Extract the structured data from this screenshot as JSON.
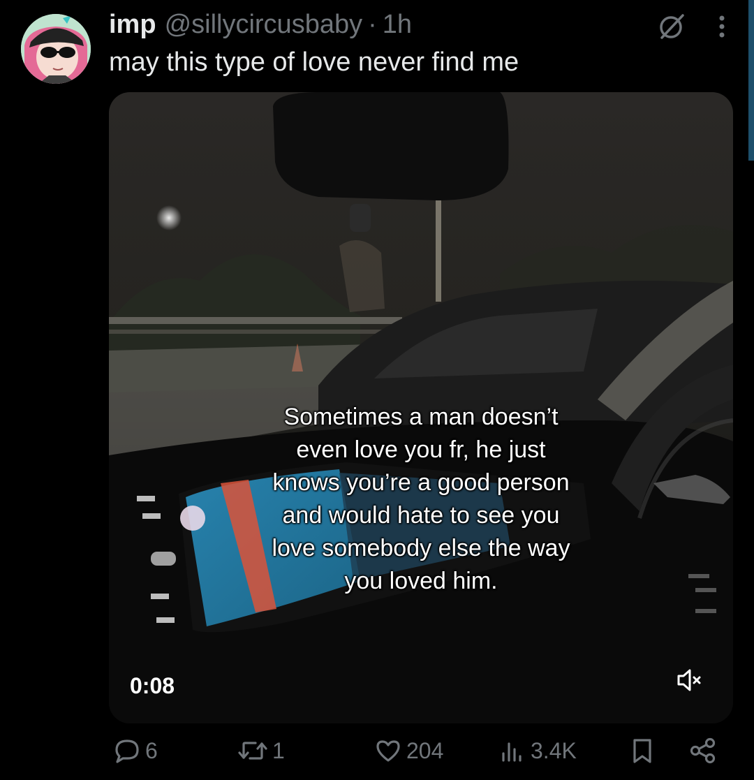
{
  "author": {
    "display_name": "imp",
    "handle": "@sillycircusbaby",
    "separator": "·",
    "time": "1h"
  },
  "tweet": {
    "text": "may this type of love never find me"
  },
  "top_icons": [
    "grok-icon",
    "more-icon"
  ],
  "media": {
    "caption_lines": [
      "Sometimes a man doesn’t",
      "even love you fr, he just",
      "knows you’re a good person",
      "and would hate to see you",
      "love somebody else the way",
      "you loved him."
    ],
    "elapsed_time": "0:08",
    "muted": true
  },
  "actions": {
    "replies": "6",
    "reposts": "1",
    "likes": "204",
    "views": "3.4K"
  },
  "colors": {
    "background": "#000000",
    "text_primary": "#e7e9ea",
    "text_secondary": "#71767b"
  }
}
